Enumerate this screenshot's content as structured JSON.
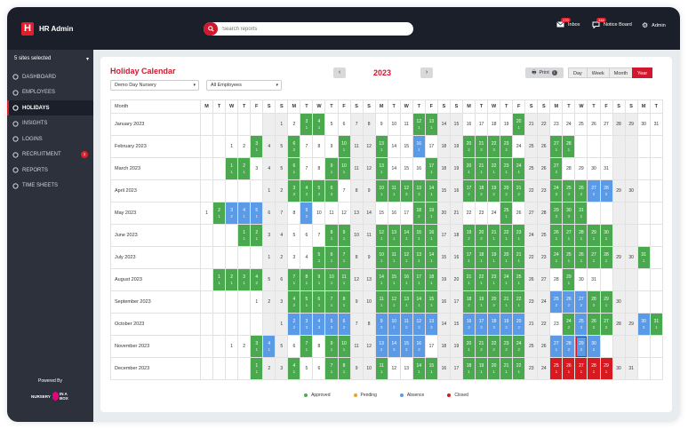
{
  "app": {
    "title": "HR Admin",
    "logo_letter": "H"
  },
  "search": {
    "placeholder": "Search reports"
  },
  "topnav": [
    {
      "label": "Inbox",
      "badge": "170",
      "icon": "envelope-icon"
    },
    {
      "label": "Notice Board",
      "badge": "134",
      "icon": "chat-icon"
    },
    {
      "label": "Admin",
      "badge": "",
      "icon": "gear-icon"
    }
  ],
  "sidebar": {
    "sites_label": "5 sites selected",
    "items": [
      {
        "label": "Dashboard",
        "icon": "dashboard-icon",
        "active": false,
        "badge": ""
      },
      {
        "label": "Employees",
        "icon": "users-icon",
        "active": false,
        "badge": ""
      },
      {
        "label": "Holidays",
        "icon": "circle-icon",
        "active": true,
        "badge": ""
      },
      {
        "label": "Insights",
        "icon": "chart-icon",
        "active": false,
        "badge": ""
      },
      {
        "label": "Logins",
        "icon": "key-icon",
        "active": false,
        "badge": ""
      },
      {
        "label": "Recruitment",
        "icon": "lock-icon",
        "active": false,
        "badge": "1"
      },
      {
        "label": "Reports",
        "icon": "file-icon",
        "active": false,
        "badge": ""
      },
      {
        "label": "Time Sheets",
        "icon": "clock-icon",
        "active": false,
        "badge": ""
      }
    ],
    "powered_by": "Powered By",
    "powered_brand_a": "NURSERY",
    "powered_brand_b": "IN A BOX"
  },
  "calendar": {
    "title": "Holiday Calendar",
    "site_filter": "Demo Day Nursery",
    "employee_filter": "All Employees",
    "year": "2023",
    "prev_icon": "chevron-left-icon",
    "next_icon": "chevron-right-icon",
    "print_label": "Print",
    "views": [
      "Day",
      "Week",
      "Month",
      "Year"
    ],
    "active_view": "Year",
    "month_header": "Month",
    "weekdays": [
      "M",
      "T",
      "W",
      "T",
      "F",
      "S",
      "S",
      "M",
      "T",
      "W",
      "T",
      "F",
      "S",
      "S",
      "M",
      "T",
      "W",
      "T",
      "F",
      "S",
      "S",
      "M",
      "T",
      "W",
      "T",
      "F",
      "S",
      "S",
      "M",
      "T",
      "W",
      "T",
      "F",
      "S",
      "S",
      "M",
      "T"
    ],
    "months": [
      {
        "name": "January 2023",
        "offset": 6,
        "days": 31,
        "marks": {
          "3": [
            "a",
            1
          ],
          "4": [
            "a",
            1
          ],
          "12": [
            "a",
            1
          ],
          "13": [
            "a",
            1
          ],
          "20": [
            "a",
            1
          ]
        }
      },
      {
        "name": "February 2023",
        "offset": 2,
        "days": 28,
        "marks": {
          "3": [
            "a",
            1
          ],
          "6": [
            "a",
            2
          ],
          "10": [
            "a",
            1
          ],
          "13": [
            "a",
            1
          ],
          "16": [
            "b",
            1
          ],
          "20": [
            "a",
            2
          ],
          "21": [
            "a",
            2
          ],
          "22": [
            "a",
            3
          ],
          "23": [
            "a",
            2
          ],
          "27": [
            "a",
            1
          ],
          "28": [
            "a",
            1
          ]
        }
      },
      {
        "name": "March 2023",
        "offset": 2,
        "days": 31,
        "marks": {
          "1": [
            "a",
            1
          ],
          "2": [
            "a",
            1
          ],
          "6": [
            "a",
            1
          ],
          "9": [
            "a",
            1
          ],
          "10": [
            "a",
            1
          ],
          "13": [
            "a",
            1
          ],
          "17": [
            "a",
            1
          ],
          "20": [
            "a",
            1
          ],
          "21": [
            "a",
            1
          ],
          "22": [
            "a",
            1
          ],
          "23": [
            "a",
            1
          ],
          "24": [
            "a",
            1
          ],
          "27": [
            "a",
            2
          ]
        }
      },
      {
        "name": "April 2023",
        "offset": 5,
        "days": 30,
        "marks": {
          "3": [
            "a",
            3
          ],
          "4": [
            "a",
            3
          ],
          "5": [
            "a",
            2
          ],
          "6": [
            "a",
            3
          ],
          "10": [
            "a",
            1
          ],
          "11": [
            "a",
            1
          ],
          "12": [
            "a",
            3
          ],
          "13": [
            "a",
            3
          ],
          "14": [
            "a",
            1
          ],
          "17": [
            "a",
            2
          ],
          "18": [
            "a",
            2
          ],
          "19": [
            "a",
            2
          ],
          "20": [
            "a",
            2
          ],
          "21": [
            "a",
            2
          ],
          "24": [
            "a",
            3
          ],
          "25": [
            "a",
            3
          ],
          "26": [
            "a",
            2
          ],
          "27": [
            "b",
            2
          ],
          "28": [
            "b",
            2
          ]
        }
      },
      {
        "name": "May 2023",
        "offset": 0,
        "days": 31,
        "marks": {
          "2": [
            "a",
            1
          ],
          "3": [
            "b",
            2
          ],
          "4": [
            "b",
            1
          ],
          "5": [
            "b",
            1
          ],
          "9": [
            "b",
            2
          ],
          "18": [
            "a",
            2
          ],
          "19": [
            "a",
            1
          ],
          "25": [
            "a",
            1
          ],
          "29": [
            "a",
            3
          ],
          "30": [
            "a",
            3
          ],
          "31": [
            "a",
            1
          ]
        }
      },
      {
        "name": "June 2023",
        "offset": 3,
        "days": 30,
        "marks": {
          "1": [
            "a",
            1
          ],
          "2": [
            "a",
            1
          ],
          "8": [
            "a",
            1
          ],
          "9": [
            "a",
            1
          ],
          "12": [
            "a",
            1
          ],
          "13": [
            "a",
            1
          ],
          "14": [
            "a",
            1
          ],
          "15": [
            "a",
            1
          ],
          "16": [
            "a",
            1
          ],
          "19": [
            "a",
            2
          ],
          "20": [
            "a",
            2
          ],
          "21": [
            "a",
            1
          ],
          "22": [
            "a",
            1
          ],
          "23": [
            "a",
            1
          ],
          "26": [
            "a",
            1
          ],
          "27": [
            "a",
            1
          ],
          "28": [
            "a",
            1
          ],
          "29": [
            "a",
            1
          ],
          "30": [
            "a",
            1
          ]
        }
      },
      {
        "name": "July 2023",
        "offset": 5,
        "days": 31,
        "marks": {
          "5": [
            "a",
            1
          ],
          "6": [
            "a",
            1
          ],
          "7": [
            "a",
            1
          ],
          "10": [
            "a",
            1
          ],
          "11": [
            "a",
            1
          ],
          "12": [
            "a",
            1
          ],
          "13": [
            "a",
            1
          ],
          "14": [
            "a",
            1
          ],
          "17": [
            "a",
            1
          ],
          "18": [
            "a",
            1
          ],
          "19": [
            "a",
            1
          ],
          "20": [
            "a",
            1
          ],
          "21": [
            "a",
            1
          ],
          "24": [
            "a",
            1
          ],
          "25": [
            "a",
            1
          ],
          "26": [
            "a",
            1
          ],
          "27": [
            "a",
            1
          ],
          "28": [
            "a",
            1
          ],
          "31": [
            "a",
            1
          ]
        }
      },
      {
        "name": "August 2023",
        "offset": 1,
        "days": 31,
        "marks": {
          "1": [
            "a",
            1
          ],
          "2": [
            "a",
            1
          ],
          "3": [
            "a",
            1
          ],
          "4": [
            "a",
            2
          ],
          "7": [
            "a",
            1
          ],
          "8": [
            "a",
            1
          ],
          "9": [
            "a",
            1
          ],
          "10": [
            "a",
            1
          ],
          "11": [
            "a",
            1
          ],
          "14": [
            "a",
            1
          ],
          "15": [
            "a",
            1
          ],
          "16": [
            "a",
            1
          ],
          "17": [
            "a",
            1
          ],
          "18": [
            "a",
            1
          ],
          "21": [
            "a",
            1
          ],
          "22": [
            "a",
            1
          ],
          "23": [
            "a",
            1
          ],
          "24": [
            "a",
            1
          ],
          "25": [
            "a",
            1
          ],
          "29": [
            "a",
            1
          ]
        }
      },
      {
        "name": "September 2023",
        "offset": 4,
        "days": 30,
        "marks": {
          "4": [
            "a",
            2
          ],
          "5": [
            "a",
            1
          ],
          "6": [
            "a",
            1
          ],
          "7": [
            "a",
            1
          ],
          "8": [
            "a",
            1
          ],
          "11": [
            "a",
            1
          ],
          "12": [
            "a",
            1
          ],
          "13": [
            "a",
            1
          ],
          "14": [
            "a",
            1
          ],
          "15": [
            "a",
            1
          ],
          "18": [
            "a",
            2
          ],
          "19": [
            "a",
            1
          ],
          "20": [
            "a",
            3
          ],
          "21": [
            "a",
            1
          ],
          "22": [
            "a",
            1
          ],
          "25": [
            "b",
            2
          ],
          "26": [
            "b",
            2
          ],
          "27": [
            "b",
            2
          ],
          "28": [
            "a",
            2
          ],
          "29": [
            "a",
            1
          ]
        }
      },
      {
        "name": "October 2023",
        "offset": 6,
        "days": 31,
        "marks": {
          "2": [
            "b",
            2
          ],
          "3": [
            "b",
            3
          ],
          "4": [
            "b",
            3
          ],
          "5": [
            "b",
            3
          ],
          "6": [
            "b",
            2
          ],
          "9": [
            "b",
            3
          ],
          "10": [
            "b",
            2
          ],
          "11": [
            "b",
            2
          ],
          "12": [
            "b",
            3
          ],
          "13": [
            "b",
            3
          ],
          "16": [
            "b",
            3
          ],
          "17": [
            "b",
            3
          ],
          "18": [
            "b",
            3
          ],
          "19": [
            "b",
            2
          ],
          "20": [
            "b",
            2
          ],
          "24": [
            "a",
            2
          ],
          "25": [
            "b",
            3
          ],
          "26": [
            "a",
            2
          ],
          "27": [
            "a",
            2
          ],
          "30": [
            "b",
            3
          ],
          "31": [
            "a",
            1
          ]
        }
      },
      {
        "name": "November 2023",
        "offset": 2,
        "days": 30,
        "marks": {
          "3": [
            "a",
            1
          ],
          "4": [
            "b",
            1
          ],
          "7": [
            "a",
            1
          ],
          "9": [
            "a",
            1
          ],
          "10": [
            "a",
            1
          ],
          "13": [
            "b",
            2
          ],
          "14": [
            "b",
            3
          ],
          "15": [
            "b",
            3
          ],
          "16": [
            "b",
            3
          ],
          "20": [
            "a",
            1
          ],
          "21": [
            "a",
            2
          ],
          "22": [
            "a",
            2
          ],
          "23": [
            "a",
            2
          ],
          "24": [
            "a",
            2
          ],
          "27": [
            "b",
            1
          ],
          "28": [
            "b",
            2
          ],
          "29": [
            "b",
            2
          ],
          "30": [
            "b",
            2
          ]
        }
      },
      {
        "name": "December 2023",
        "offset": 4,
        "days": 31,
        "marks": {
          "1": [
            "a",
            1
          ],
          "4": [
            "a",
            1
          ],
          "7": [
            "a",
            1
          ],
          "8": [
            "a",
            1
          ],
          "11": [
            "a",
            1
          ],
          "14": [
            "a",
            1
          ],
          "15": [
            "a",
            1
          ],
          "18": [
            "a",
            1
          ],
          "19": [
            "a",
            1
          ],
          "20": [
            "a",
            1
          ],
          "21": [
            "a",
            1
          ],
          "22": [
            "a",
            1
          ],
          "25": [
            "c",
            1
          ],
          "26": [
            "c",
            1
          ],
          "27": [
            "c",
            1
          ],
          "28": [
            "c",
            1
          ],
          "29": [
            "c",
            1
          ]
        }
      }
    ],
    "selected_day": {
      "month": 10,
      "day": 29
    },
    "legend": [
      {
        "label": "Approved",
        "color": "#4aa94e"
      },
      {
        "label": "Pending",
        "color": "#f0a020"
      },
      {
        "label": "Absence",
        "color": "#5b9ae6"
      },
      {
        "label": "Closed",
        "color": "#d71920"
      }
    ]
  }
}
